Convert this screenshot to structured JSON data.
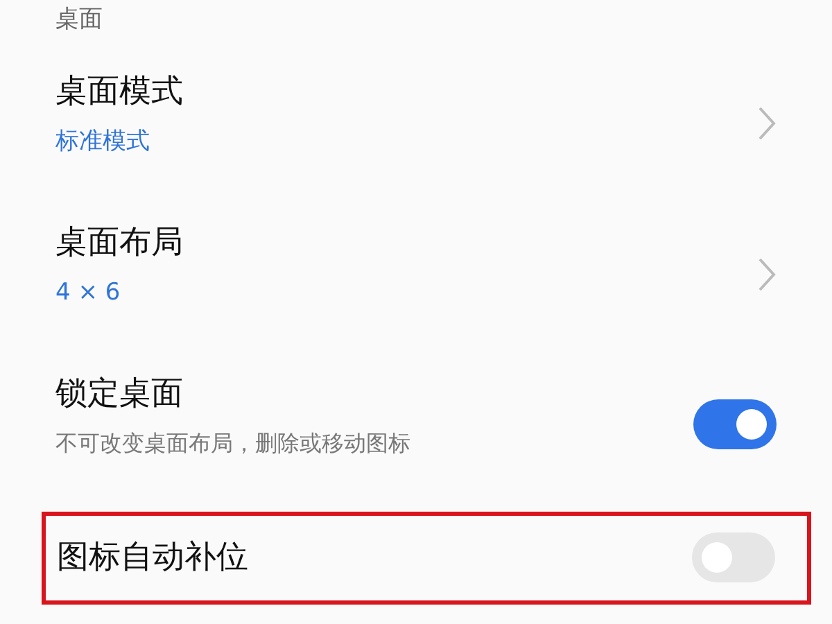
{
  "section": {
    "title": "桌面"
  },
  "items": [
    {
      "kind": "link",
      "title": "桌面模式",
      "value": "标准模式",
      "highlighted": false
    },
    {
      "kind": "link",
      "title": "桌面布局",
      "value": "4 × 6",
      "highlighted": false
    },
    {
      "kind": "toggle",
      "title": "锁定桌面",
      "description": "不可改变桌面布局，删除或移动图标",
      "on": true,
      "highlighted": false
    },
    {
      "kind": "toggle",
      "title": "图标自动补位",
      "on": false,
      "highlighted": true
    }
  ]
}
